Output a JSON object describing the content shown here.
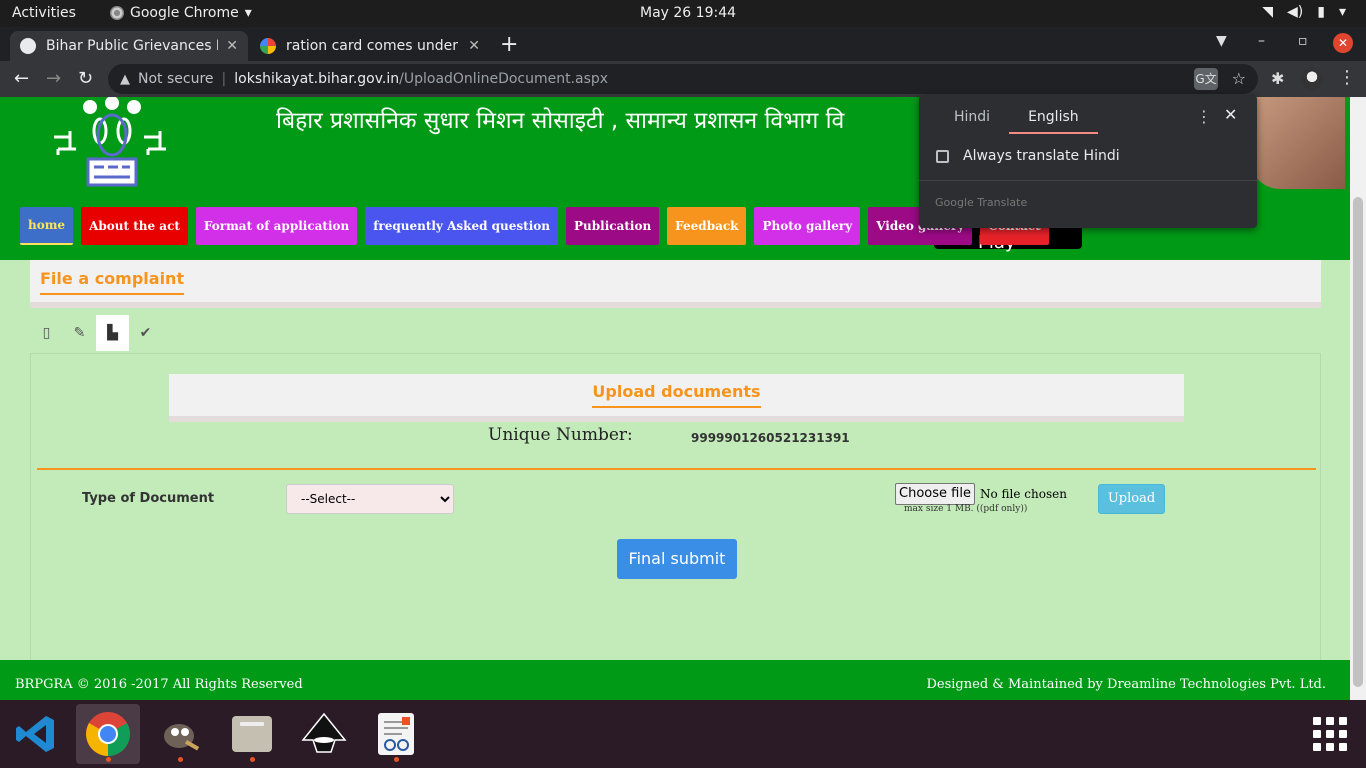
{
  "system": {
    "activities": "Activities",
    "app_name": "Google Chrome",
    "clock": "May 26  19:44"
  },
  "tabs": [
    {
      "title": "Bihar Public Grievances Re",
      "active": true
    },
    {
      "title": "ration card comes under w",
      "active": false
    }
  ],
  "address": {
    "security": "Not secure",
    "host": "lokshikayat.bihar.gov.in",
    "path": "/UploadOnlineDocument.aspx"
  },
  "site": {
    "hindi_title": "बिहार प्रशासनिक सुधार मिशन सोसाइटी ,  सामान्य प्रशासन विभाग वि",
    "google_play": "Google Play",
    "nav": [
      {
        "label": "home",
        "color": "#3e6fc8"
      },
      {
        "label": "About the act",
        "color": "#e80000"
      },
      {
        "label": "Format of application",
        "color": "#d12fe8"
      },
      {
        "label": "frequently Asked question",
        "color": "#4a55f0"
      },
      {
        "label": "Publication",
        "color": "#9c0a86"
      },
      {
        "label": "Feedback",
        "color": "#f7941d"
      },
      {
        "label": "Photo gallery",
        "color": "#d12fe8"
      },
      {
        "label": "Video gallery",
        "color": "#9c0a86"
      },
      {
        "label": "Contact",
        "color": "#e8222a"
      }
    ],
    "complaint_label": "File a complaint",
    "upload_heading": "Upload documents",
    "unique_label": "Unique Number:",
    "unique_value": "9999901260521231391",
    "doc_type_label": "Type of Document",
    "doc_type_selected": "--Select--",
    "choose_file": "Choose file",
    "file_status": "No file chosen",
    "file_hint": "max size 1 MB. ((pdf only))",
    "upload_button": "Upload",
    "final_submit": "Final submit",
    "footer_left": "BRPGRA © 2016 -2017 All Rights Reserved",
    "footer_right": "Designed & Maintained by Dreamline Technologies Pvt. Ltd."
  },
  "translate": {
    "source": "Hindi",
    "target": "English",
    "always": "Always translate Hindi",
    "brand": "Google Translate"
  }
}
